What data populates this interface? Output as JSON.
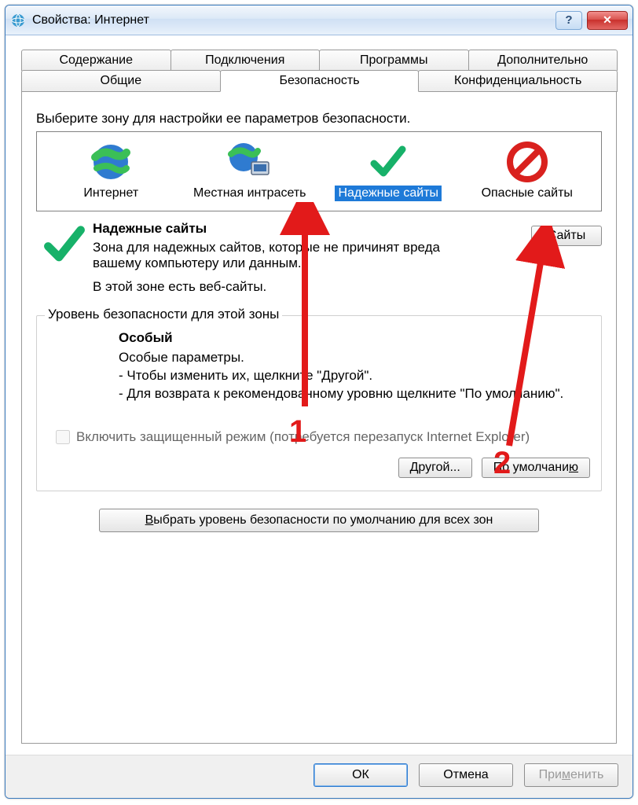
{
  "window": {
    "title": "Свойства: Интернет"
  },
  "tabs": {
    "row1": [
      "Содержание",
      "Подключения",
      "Программы",
      "Дополнительно"
    ],
    "row2": [
      "Общие",
      "Безопасность",
      "Конфиденциальность"
    ],
    "active": "Безопасность"
  },
  "security": {
    "instruction": "Выберите зону для настройки ее параметров безопасности.",
    "zones": [
      {
        "label": "Интернет"
      },
      {
        "label": "Местная интрасеть"
      },
      {
        "label": "Надежные сайты"
      },
      {
        "label": "Опасные сайты"
      }
    ],
    "selected_index": 2,
    "desc": {
      "title": "Надежные сайты",
      "body": "Зона для надежных сайтов, которые не причинят вреда вашему компьютеру или данным.",
      "note": "В этой зоне есть веб-сайты."
    },
    "sites_button": "Сайты",
    "group_legend": "Уровень безопасности для этой зоны",
    "level": {
      "title": "Особый",
      "line1": "Особые параметры.",
      "line2": "- Чтобы изменить их, щелкните \"Другой\".",
      "line3": "- Для возврата к рекомендованному уровню щелкните \"По умолчанию\"."
    },
    "protected_mode": "Включить защищенный режим (потребуется перезапуск Internet Explorer)",
    "custom_button": "Другой...",
    "default_button": "По умолчанию",
    "reset_all_button": "Выбрать уровень безопасности по умолчанию для всех зон"
  },
  "dialog_buttons": {
    "ok": "ОК",
    "cancel": "Отмена",
    "apply": "Применить"
  },
  "annotations": {
    "a1": "1",
    "a2": "2"
  }
}
